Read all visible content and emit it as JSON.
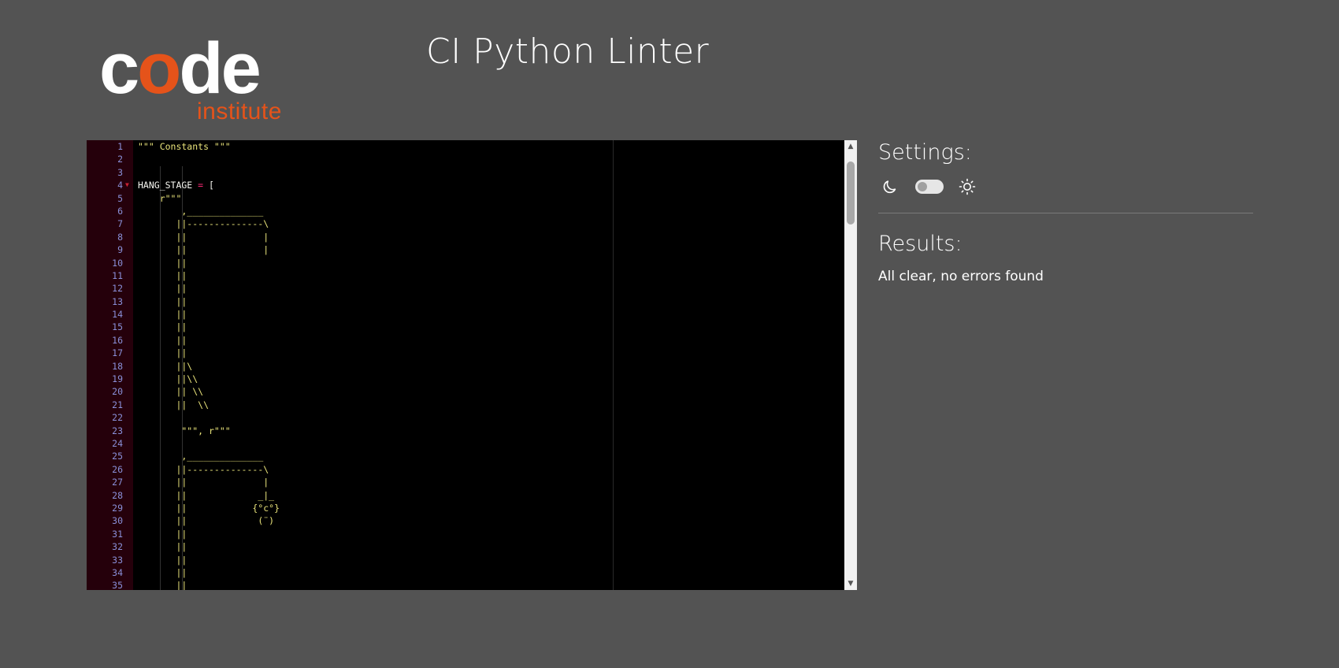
{
  "header": {
    "logo_word_a": "c",
    "logo_word_o": "o",
    "logo_word_b": "de",
    "logo_sub": "institute",
    "title": "CI Python Linter"
  },
  "editor": {
    "lines": [
      {
        "n": "1",
        "text": "\"\"\" Constants \"\"\"",
        "white": false
      },
      {
        "n": "2",
        "text": ""
      },
      {
        "n": "3",
        "text": ""
      },
      {
        "n": "4",
        "text": "HANG_STAGE = [",
        "white": true,
        "fold": true
      },
      {
        "n": "5",
        "text": "    r\"\"\""
      },
      {
        "n": "6",
        "text": "        ,______________"
      },
      {
        "n": "7",
        "text": "       ||--------------\\"
      },
      {
        "n": "8",
        "text": "       ||              |"
      },
      {
        "n": "9",
        "text": "       ||              |"
      },
      {
        "n": "10",
        "text": "       ||"
      },
      {
        "n": "11",
        "text": "       ||"
      },
      {
        "n": "12",
        "text": "       ||"
      },
      {
        "n": "13",
        "text": "       ||"
      },
      {
        "n": "14",
        "text": "       ||"
      },
      {
        "n": "15",
        "text": "       ||"
      },
      {
        "n": "16",
        "text": "       ||"
      },
      {
        "n": "17",
        "text": "       ||"
      },
      {
        "n": "18",
        "text": "       ||\\"
      },
      {
        "n": "19",
        "text": "       ||\\\\"
      },
      {
        "n": "20",
        "text": "       || \\\\"
      },
      {
        "n": "21",
        "text": "       ||  \\\\"
      },
      {
        "n": "22",
        "text": ""
      },
      {
        "n": "23",
        "text": "        \"\"\", r\"\"\""
      },
      {
        "n": "24",
        "text": ""
      },
      {
        "n": "25",
        "text": "        ,______________"
      },
      {
        "n": "26",
        "text": "       ||--------------\\"
      },
      {
        "n": "27",
        "text": "       ||              |"
      },
      {
        "n": "28",
        "text": "       ||             _|_"
      },
      {
        "n": "29",
        "text": "       ||            {°c°}"
      },
      {
        "n": "30",
        "text": "       ||             (¨)"
      },
      {
        "n": "31",
        "text": "       ||"
      },
      {
        "n": "32",
        "text": "       ||"
      },
      {
        "n": "33",
        "text": "       ||"
      },
      {
        "n": "34",
        "text": "       ||"
      },
      {
        "n": "35",
        "text": "       ||"
      }
    ],
    "scroll_up_icon": "▲",
    "scroll_down_icon": "▼"
  },
  "settings": {
    "title": "Settings:",
    "dark_icon": "moon-icon",
    "light_icon": "sun-icon"
  },
  "results": {
    "title": "Results:",
    "message": "All clear, no errors found"
  }
}
